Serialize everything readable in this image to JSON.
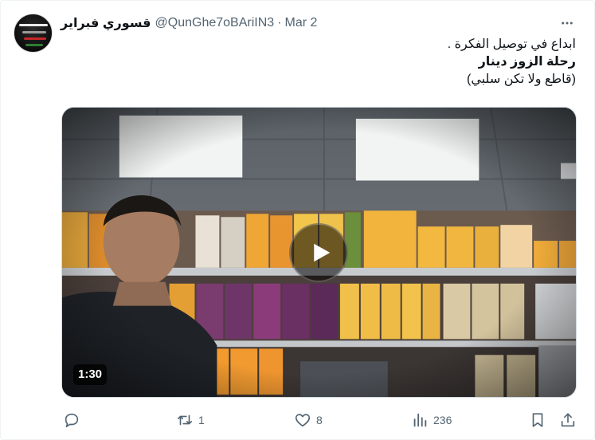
{
  "author": {
    "display_name": "قسوري فبراير",
    "handle": "@QunGhe7oBAriIN3",
    "separator": "·",
    "date": "Mar 2"
  },
  "tweet": {
    "lines": [
      "ابداع في توصيل الفكرة .",
      "رحلة الزوز دينار",
      "(قاطع ولا تكن سلبي)"
    ]
  },
  "media": {
    "duration": "1:30"
  },
  "actions": {
    "reply_count": "",
    "retweet_count": "1",
    "like_count": "8",
    "views_count": "236"
  },
  "colors": {
    "text_primary": "#0f1419",
    "text_secondary": "#536471",
    "border": "#cfd9de"
  },
  "icons": [
    "more-icon",
    "play-icon",
    "reply-icon",
    "retweet-icon",
    "like-icon",
    "views-icon",
    "bookmark-icon",
    "share-icon"
  ]
}
